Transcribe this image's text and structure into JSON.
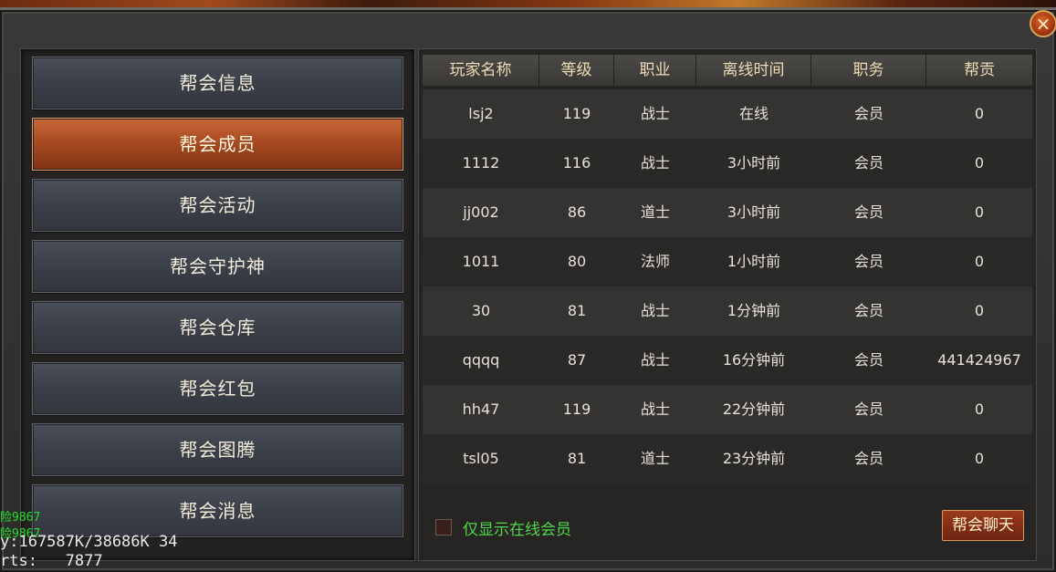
{
  "window": {
    "close_icon": "×"
  },
  "tabs": [
    {
      "label": "帮会信息",
      "active": false
    },
    {
      "label": "帮会成员",
      "active": true
    },
    {
      "label": "帮会活动",
      "active": false
    },
    {
      "label": "帮会守护神",
      "active": false
    },
    {
      "label": "帮会仓库",
      "active": false
    },
    {
      "label": "帮会红包",
      "active": false
    },
    {
      "label": "帮会图腾",
      "active": false
    },
    {
      "label": "帮会消息",
      "active": false
    }
  ],
  "table": {
    "headers": [
      "玩家名称",
      "等级",
      "职业",
      "离线时间",
      "职务",
      "帮贡"
    ],
    "rows": [
      [
        "lsj2",
        "119",
        "战士",
        "在线",
        "会员",
        "0"
      ],
      [
        "1112",
        "116",
        "战士",
        "3小时前",
        "会员",
        "0"
      ],
      [
        "jj002",
        "86",
        "道士",
        "3小时前",
        "会员",
        "0"
      ],
      [
        "1011",
        "80",
        "法师",
        "1小时前",
        "会员",
        "0"
      ],
      [
        "30",
        "81",
        "战士",
        "1分钟前",
        "会员",
        "0"
      ],
      [
        "qqqq",
        "87",
        "战士",
        "16分钟前",
        "会员",
        "441424967"
      ],
      [
        "hh47",
        "119",
        "战士",
        "22分钟前",
        "会员",
        "0"
      ],
      [
        "tsl05",
        "81",
        "道士",
        "23分钟前",
        "会员",
        "0"
      ]
    ]
  },
  "footer": {
    "online_only_label": "仅显示在线会员",
    "online_only_checked": false,
    "chat_button": "帮会聊天"
  },
  "debug_overlay": {
    "line1": "险9867",
    "line2": "险9867",
    "line3": "y:167587K/38686K 34",
    "line4": "rts:   7877"
  },
  "colors": {
    "active_tab": "#b2542a",
    "check_label": "#4fd54a",
    "header_text": "#eddcb8"
  }
}
